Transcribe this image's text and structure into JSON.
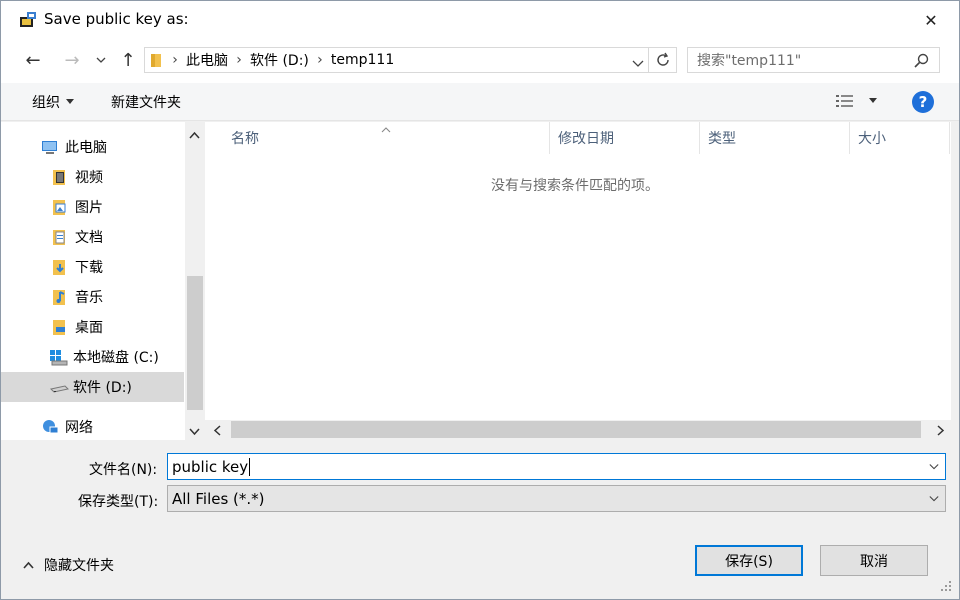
{
  "window": {
    "title": "Save public key as:",
    "close_symbol": "✕"
  },
  "nav": {
    "back_symbol": "←",
    "forward_symbol": "→",
    "recent_symbol": "⌄",
    "up_symbol": "↑"
  },
  "address": {
    "segments": [
      "此电脑",
      "软件 (D:)",
      "temp111"
    ]
  },
  "search": {
    "placeholder": "搜索\"temp111\""
  },
  "toolbar": {
    "organize_label": "组织",
    "new_folder_label": "新建文件夹",
    "help_label": "?"
  },
  "tree": {
    "items": [
      {
        "label": "此电脑",
        "icon": "computer-icon"
      },
      {
        "label": "视频",
        "icon": "video-folder-icon"
      },
      {
        "label": "图片",
        "icon": "pictures-folder-icon"
      },
      {
        "label": "文档",
        "icon": "documents-folder-icon"
      },
      {
        "label": "下载",
        "icon": "downloads-folder-icon"
      },
      {
        "label": "音乐",
        "icon": "music-folder-icon"
      },
      {
        "label": "桌面",
        "icon": "desktop-folder-icon"
      },
      {
        "label": "本地磁盘 (C:)",
        "icon": "system-drive-icon"
      },
      {
        "label": "软件 (D:)",
        "icon": "drive-icon"
      },
      {
        "label": "网络",
        "icon": "network-icon"
      }
    ]
  },
  "filelist": {
    "columns": [
      "名称",
      "修改日期",
      "类型",
      "大小"
    ],
    "empty_message": "没有与搜索条件匹配的项。"
  },
  "form": {
    "filename_label": "文件名(N):",
    "filename_value": "public key",
    "filetype_label": "保存类型(T):",
    "filetype_value": "All Files (*.*)"
  },
  "footer": {
    "hide_folders_label": "隐藏文件夹",
    "save_label": "保存(S)",
    "cancel_label": "取消"
  },
  "colors": {
    "accent": "#0078d7",
    "help": "#1e6fd9",
    "folder": "#f2c14e"
  }
}
